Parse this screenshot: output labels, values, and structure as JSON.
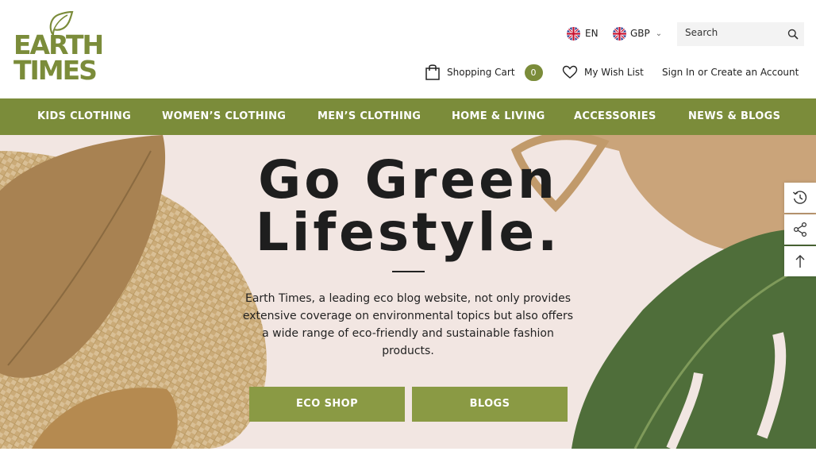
{
  "brand": {
    "logo_line1": "EARTH",
    "logo_line2": "TIMES",
    "color": "#7b8c3a"
  },
  "header": {
    "language": "EN",
    "currency": "GBP",
    "search_placeholder": "Search",
    "cart_label": "Shopping Cart",
    "cart_count": "0",
    "wishlist_label": "My Wish List",
    "sign_in": "Sign In",
    "or": "or",
    "create_account": "Create an Account"
  },
  "nav": {
    "items": [
      {
        "label": "KIDS CLOTHING"
      },
      {
        "label": "WOMEN’S CLOTHING"
      },
      {
        "label": "MEN’S CLOTHING"
      },
      {
        "label": "HOME & LIVING"
      },
      {
        "label": "ACCESSORIES"
      },
      {
        "label": "NEWS & BLOGS"
      }
    ]
  },
  "hero": {
    "title_line1": "Go Green",
    "title_line2": "Lifestyle.",
    "description": "Earth Times, a leading eco blog website, not only provides extensive coverage on environmental topics but also offers a wide range of eco-friendly and sustainable fashion products.",
    "button_primary": "ECO SHOP",
    "button_secondary": "BLOGS",
    "background_color": "#f2e6e2"
  },
  "side_tools": {
    "icons": [
      "history-icon",
      "share-icon",
      "arrow-up-icon"
    ]
  }
}
